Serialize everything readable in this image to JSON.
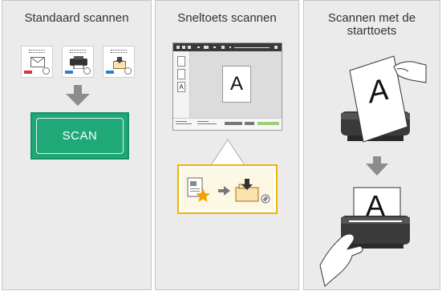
{
  "panels": [
    {
      "title": "Standaard scannen"
    },
    {
      "title": "Sneltoets scannen"
    },
    {
      "title_line1": "Scannen met de",
      "title_line2": "starttoets"
    }
  ],
  "standard": {
    "button_label": "SCAN",
    "cards": [
      {
        "icon": "envelope-icon",
        "tag_color": "#d9363e"
      },
      {
        "icon": "printer-icon",
        "tag_color": "#2a7fd4"
      },
      {
        "icon": "folder-icon",
        "tag_color": "#2a7fd4"
      }
    ]
  },
  "shortcut": {
    "thumbs": [
      "",
      "",
      "A"
    ],
    "page_letter": "A"
  },
  "starttoets": {
    "doc_letter_top": "A",
    "doc_letter_bottom": "A"
  },
  "colors": {
    "scan_green": "#20a878",
    "callout_border": "#f0b400",
    "arrow_gray": "#8c8c8c",
    "star": "#f5a000"
  }
}
